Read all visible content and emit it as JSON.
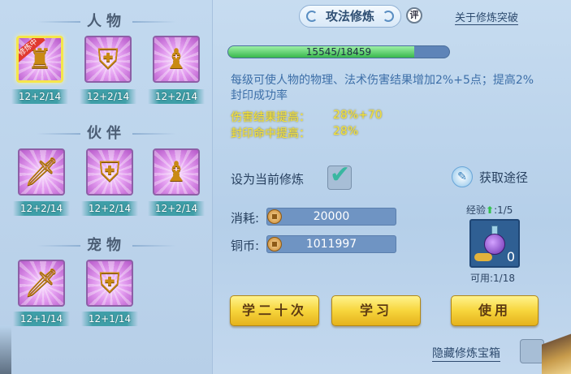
{
  "left": {
    "sections": [
      {
        "title": "人物",
        "slots": [
          {
            "level": "12+2/14",
            "icon": "character-bust-icon",
            "selected": true,
            "tag": "修炼中"
          },
          {
            "level": "12+2/14",
            "icon": "character-shield-icon",
            "selected": false
          },
          {
            "level": "12+2/14",
            "icon": "character-armor-icon",
            "selected": false
          }
        ]
      },
      {
        "title": "伙伴",
        "slots": [
          {
            "level": "12+2/14",
            "icon": "partner-sword-icon"
          },
          {
            "level": "12+2/14",
            "icon": "partner-shield-icon"
          },
          {
            "level": "12+2/14",
            "icon": "partner-armor-icon"
          }
        ]
      },
      {
        "title": "宠物",
        "slots": [
          {
            "level": "12+1/14",
            "icon": "pet-sword-icon"
          },
          {
            "level": "12+1/14",
            "icon": "pet-shield-icon"
          }
        ]
      }
    ]
  },
  "header": {
    "tab_label": "攻法修炼",
    "comment_label": "评",
    "about_link": "关于修炼突破"
  },
  "progress": {
    "current": 15545,
    "max": 18459,
    "text": "15545/18459"
  },
  "description": "每级可使人物的物理、法术伤害结果增加2%+5点；提高2%封印成功率",
  "effects": [
    {
      "label": "伤害结果提高：",
      "value": "28%+70"
    },
    {
      "label": "封印命中提高：",
      "value": "28%"
    }
  ],
  "set_current": {
    "label": "设为当前修炼",
    "checked": true
  },
  "get_way": {
    "label": "获取途径"
  },
  "costs": {
    "consume_label": "消耗:",
    "consume_value": "20000",
    "copper_label": "铜币:",
    "copper_value": "1011997"
  },
  "item": {
    "exp_label": "经验",
    "exp_value": ":1/5",
    "count": "0",
    "usable": "可用:1/18"
  },
  "buttons": {
    "learn20": "学二十次",
    "learn": "学习",
    "use": "使用"
  },
  "hide": {
    "label": "隐藏修炼宝箱"
  },
  "colors": {
    "effect_text": "#f5e33a",
    "desc_text": "#3d6fa8",
    "progress_fill": "#38b84c",
    "button": "#f7d53c"
  }
}
